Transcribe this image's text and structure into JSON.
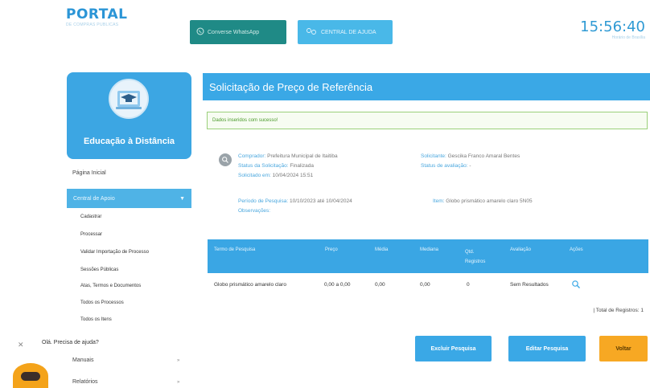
{
  "logo": {
    "title": "PORTAL",
    "subtitle": "DE COMPRAS PUBLICAS"
  },
  "header_buttons": {
    "whatsapp": "Converse WhatsApp",
    "central": "CENTRAL DE AJUDA"
  },
  "clock": {
    "time": "15:56:40",
    "subtitle": "Horário de Brasília"
  },
  "sidebar": {
    "card_title": "Educação à Distância",
    "home": "Página Inicial",
    "active": "Central de Apoio",
    "sub_items": [
      "Cadastrar",
      "Processar",
      "Validar Importação de Processo",
      "Sessões Públicas",
      "Atas, Termos e Documentos",
      "Todos os Processos",
      "Todos os Itens",
      "Manuais",
      "Relatórios"
    ]
  },
  "chat": {
    "text": "Olá. Precisa de ajuda?"
  },
  "page": {
    "title": "Solicitação de Preço de Referência",
    "success_message": "Dados inseridos com sucesso!"
  },
  "details": {
    "comprador_label": "Comprador:",
    "comprador_value": "Prefeitura Municipal de Itaitiba",
    "status_label": "Status da Solicitação:",
    "status_value": "Finalizada",
    "solicitado_label": "Solicitado em:",
    "solicitado_value": "10/04/2024 15:51",
    "solicitante_label": "Solicitante:",
    "solicitante_value": "Gescika Franco Amaral Bentes",
    "avaliacao_label": "Status de avaliação:",
    "avaliacao_value": "-",
    "periodo_label": "Período de Pesquisa:",
    "periodo_value": "10/10/2023 até 10/04/2024",
    "obs_label": "Observações:",
    "obs_value": "",
    "item_label": "Item:",
    "item_value": "Globo prismático amarelo claro 5N05"
  },
  "table": {
    "headers": [
      "Termo de Pesquisa",
      "Preço",
      "Média",
      "Mediana",
      "Qtd. Registros",
      "Avaliação",
      "Ações"
    ],
    "rows": [
      [
        "Globo prismático amarelo claro",
        "0,00 a 0,00",
        "0,00",
        "0,00",
        "0",
        "Sem Resultados"
      ]
    ],
    "total": "| Total de Registros: 1"
  },
  "actions": {
    "exclude": "Excluir Pesquisa",
    "edit": "Editar Pesquisa",
    "back": "Voltar"
  },
  "colors": {
    "primary": "#3aa8e6",
    "whatsapp": "#1f8a86",
    "orange": "#f7a823",
    "success": "#4a9a2a"
  }
}
